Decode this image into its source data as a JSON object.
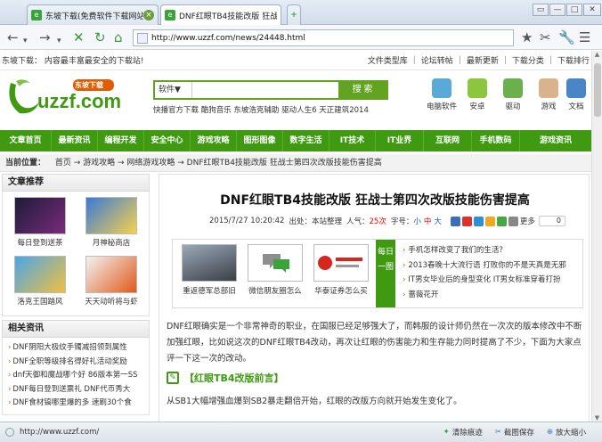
{
  "browser": {
    "tabs": [
      {
        "title": "东坡下载(免费软件下载网站",
        "active": false
      },
      {
        "title": "DNF红眼TB4技能改版 狂战士",
        "active": true
      }
    ],
    "new_tab": "+",
    "url": "http://www.uzzf.com/news/24448.html",
    "status_url": "http://www.uzzf.com/",
    "status_items": [
      "清除痕迹",
      "截图保存",
      "放大缩小"
    ]
  },
  "site": {
    "tagline": "东坡下载：   内容最丰富最安全的下载站!",
    "top_links": [
      "文件类型库",
      "论坛转帖",
      "最新更新",
      "下载分类",
      "下载排行"
    ],
    "logo_text": "uzzf.com",
    "logo_badge": "东坡下载",
    "search": {
      "category": "软件▼",
      "placeholder": "",
      "button": "搜 索"
    },
    "hotlinks": "快播官方下载  酷狗音乐  东坡浩克辅助  驱动人生6  天正建筑2014",
    "top_icons": [
      "电脑软件",
      "安卓",
      "驱动",
      "游戏",
      "文档"
    ],
    "nav": [
      "文章首页",
      "最新资讯",
      "编程开发",
      "安全中心",
      "游戏攻略",
      "图形图像",
      "数字生活",
      "IT技术",
      "IT业界",
      "互联网",
      "手机数码",
      "游戏资讯"
    ],
    "breadcrumb": {
      "label": "当前位置：",
      "path": "首页  →  游戏攻略  →  网络游戏攻略  →  DNF红眼TB4技能改版 狂战士第四次改版技能伤害提高"
    }
  },
  "sidebar": {
    "recommend_title": "文章推荐",
    "thumbs": [
      "每日登到送茶",
      "月神秘商店",
      "洛克王国踏风",
      "天天动听将与虾"
    ],
    "related_title": "相关资讯",
    "related": [
      "DNF阴阳大极纹手镯减招领到属性",
      "DNF全职等级排名得好礼活动奖励",
      "dnf天御和魔战哪个好  86版本第一SS",
      "DNF每日登到送票礼  DNF代币秀大",
      "DNF食材镐哪里爆的多  速刷30个食"
    ]
  },
  "article": {
    "title": "DNF红眼TB4技能改版  狂战士第四次改版技能伤害提高",
    "date": "2015/7/27 10:20:42",
    "source_label": "出处：",
    "source": "本站整理",
    "views_label": "人气：",
    "views": "25次",
    "fontsize_label": "字号：",
    "fontsizes": [
      "小",
      "中",
      "大"
    ],
    "more": "更多",
    "likes": "0",
    "features": [
      "重返德军总部旧",
      "微信朋友圈怎么",
      "华泰证券怎么买"
    ],
    "daily_tag": "每日一图",
    "daily": [
      "手机怎样改变了我们的生活？",
      "2013春晚十大流行语  打败你的不是天真是无邪",
      "IT男女毕业后的身型变化  IT男女标准穿着打扮",
      "蔷薇花开"
    ],
    "body1": "DNF红眼确实是一个非常神奇的职业，在国服已经足够强大了，而韩服的设计师仍然在一次次的版本修改中不断加强红眼，比如说这次的DNF红眼TB4改动，再次让红眼的伤害能力和生存能力同时提高了不少，下面为大家点评一下这一次的改动。",
    "section": "【红眼TB4改版前言】",
    "body2": "从SB1大幅增强血爆到SB2暴走翻倍开始，红眼的改版方向就开始发生变化了。"
  },
  "colors": {
    "brand_green": "#3f9a12",
    "accent_orange": "#e35b00",
    "link_blue": "#1a5fb4"
  }
}
